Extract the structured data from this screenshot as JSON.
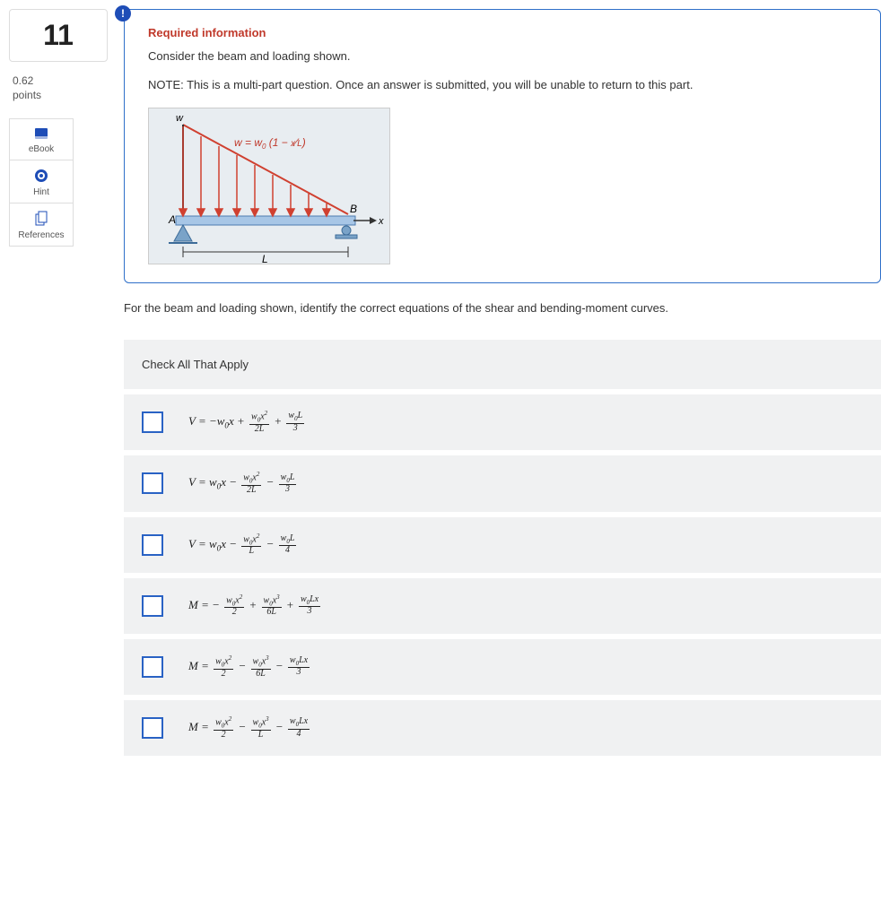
{
  "sidebar": {
    "question_number": "11",
    "points_value": "0.62",
    "points_label": "points",
    "tools": {
      "ebook": "eBook",
      "hint": "Hint",
      "references": "References"
    }
  },
  "info_badge": "!",
  "required": {
    "heading": "Required information",
    "intro": "Consider the beam and loading shown.",
    "note": "NOTE: This is a multi-part question. Once an answer is submitted, you will be unable to return to this part.",
    "figure": {
      "load_label_w": "w",
      "load_equation": "w = w₀ (1 − x⁄L)",
      "point_A": "A",
      "point_B": "B",
      "axis_x": "x",
      "length_L": "L"
    }
  },
  "prompt": "For the beam and loading shown, identify the correct equations of the shear and bending-moment curves.",
  "check_all_label": "Check All That Apply",
  "options": [
    {
      "id": "opt1",
      "eq": "V = −w₀x + w₀x²⁄2L + w₀L⁄3"
    },
    {
      "id": "opt2",
      "eq": "V = w₀x − w₀x²⁄2L − w₀L⁄3"
    },
    {
      "id": "opt3",
      "eq": "V = w₀x − w₀x²⁄L − w₀L⁄4"
    },
    {
      "id": "opt4",
      "eq": "M = −w₀x²⁄2 + w₀x³⁄6L + w₀Lx⁄3"
    },
    {
      "id": "opt5",
      "eq": "M = w₀x²⁄2 − w₀x³⁄6L − w₀Lx⁄3"
    },
    {
      "id": "opt6",
      "eq": "M = w₀x²⁄2 − w₀x³⁄L − w₀Lx⁄4"
    }
  ]
}
